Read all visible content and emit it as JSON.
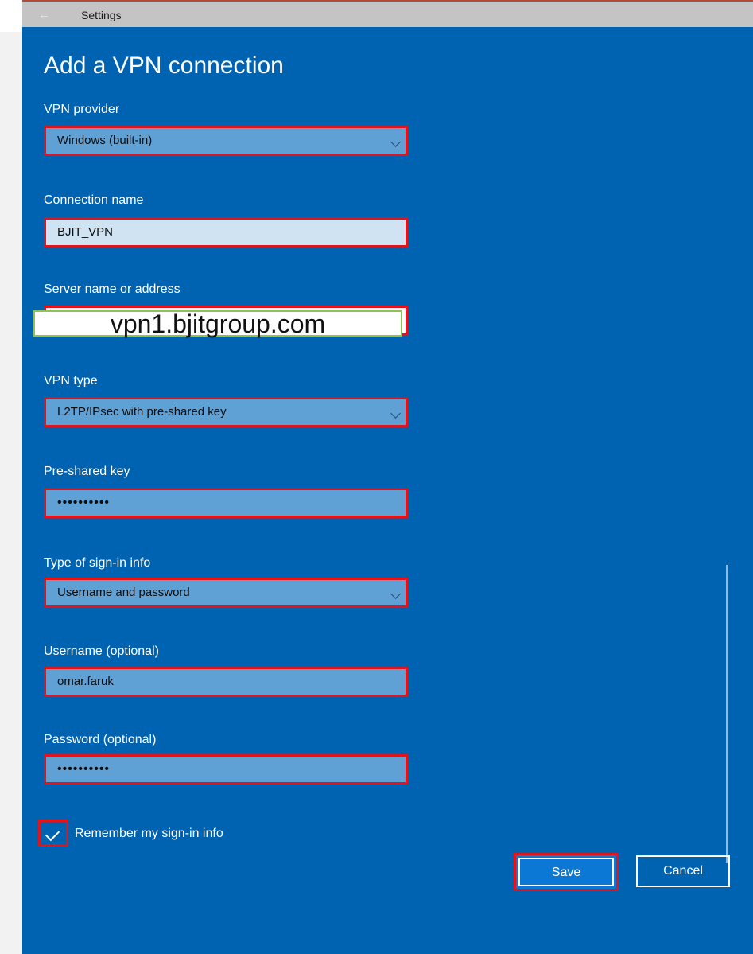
{
  "window": {
    "title": "Settings"
  },
  "page": {
    "title": "Add a VPN connection"
  },
  "form": {
    "vpn_provider": {
      "label": "VPN provider",
      "value": "Windows (built-in)"
    },
    "connection_name": {
      "label": "Connection name",
      "value": "BJIT_VPN"
    },
    "server": {
      "label": "Server name or address",
      "value": "vpn1.bjitgroup.com"
    },
    "vpn_type": {
      "label": "VPN type",
      "value": "L2TP/IPsec with pre-shared key"
    },
    "pre_shared_key": {
      "label": "Pre-shared key",
      "value": "••••••••••"
    },
    "sign_in_type": {
      "label": "Type of sign-in info",
      "value": "Username and password"
    },
    "username": {
      "label": "Username (optional)",
      "value": "omar.faruk"
    },
    "password": {
      "label": "Password (optional)",
      "value": "••••••••••"
    },
    "remember": {
      "label": "Remember my sign-in info",
      "checked": true
    }
  },
  "buttons": {
    "save": "Save",
    "cancel": "Cancel"
  },
  "icons": {
    "back": "back-arrow-icon",
    "dropdown": "chevron-down-icon",
    "check": "check-icon"
  },
  "colors": {
    "background": "#0063b1",
    "highlight": "#e0151b",
    "field": "#5fa0d5"
  }
}
